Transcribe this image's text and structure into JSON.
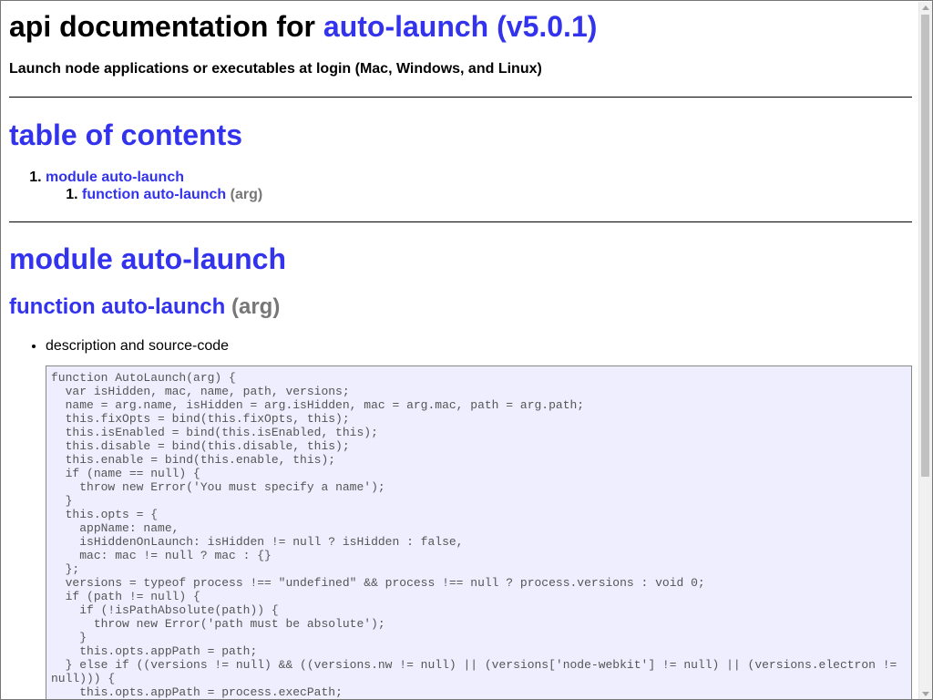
{
  "header": {
    "title_prefix": "api documentation for ",
    "title_link": "auto-launch (v5.0.1)",
    "tagline": "Launch node applications or executables at login (Mac, Windows, and Linux)"
  },
  "toc": {
    "heading": "table of contents",
    "items": [
      {
        "number": "1.",
        "label": "module auto-launch"
      }
    ],
    "subitems": [
      {
        "number": "1.",
        "label": "function auto-launch",
        "args": " (arg)"
      }
    ]
  },
  "module": {
    "heading": "module auto-launch",
    "function_name": "function auto-launch",
    "function_args": " (arg)",
    "description_label": "description and source-code",
    "source": "function AutoLaunch(arg) {\n  var isHidden, mac, name, path, versions;\n  name = arg.name, isHidden = arg.isHidden, mac = arg.mac, path = arg.path;\n  this.fixOpts = bind(this.fixOpts, this);\n  this.isEnabled = bind(this.isEnabled, this);\n  this.disable = bind(this.disable, this);\n  this.enable = bind(this.enable, this);\n  if (name == null) {\n    throw new Error('You must specify a name');\n  }\n  this.opts = {\n    appName: name,\n    isHiddenOnLaunch: isHidden != null ? isHidden : false,\n    mac: mac != null ? mac : {}\n  };\n  versions = typeof process !== \"undefined\" && process !== null ? process.versions : void 0;\n  if (path != null) {\n    if (!isPathAbsolute(path)) {\n      throw new Error('path must be absolute');\n    }\n    this.opts.appPath = path;\n  } else if ((versions != null) && ((versions.nw != null) || (versions['node-webkit'] != null) || (versions.electron != null))) {\n    this.opts.appPath = process.execPath;"
  }
}
